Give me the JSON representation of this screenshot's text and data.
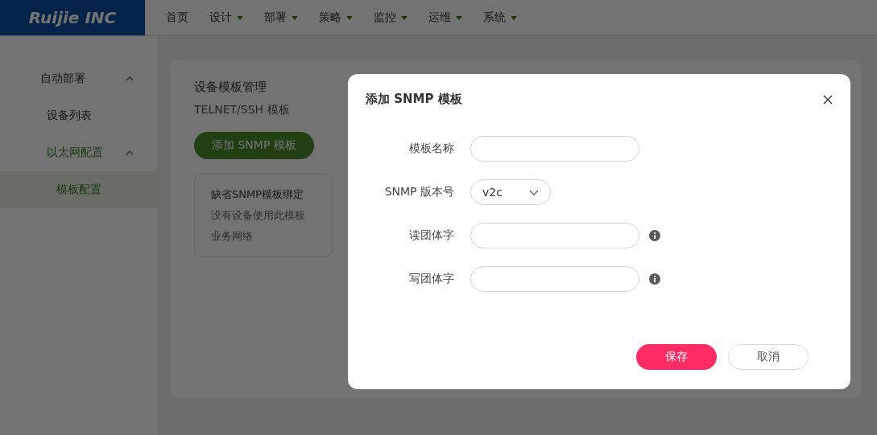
{
  "header": {
    "logo": "Ruijie INC",
    "nav": [
      {
        "label": "首页",
        "dropdown": false
      },
      {
        "label": "设计",
        "dropdown": true
      },
      {
        "label": "部署",
        "dropdown": true
      },
      {
        "label": "策略",
        "dropdown": true
      },
      {
        "label": "监控",
        "dropdown": true
      },
      {
        "label": "运维",
        "dropdown": true
      },
      {
        "label": "系统",
        "dropdown": true
      }
    ]
  },
  "sidebar": {
    "items": [
      {
        "label": "自动部署",
        "expanded": true,
        "selected": false,
        "children": [
          {
            "label": "设备列表",
            "selected": false
          },
          {
            "label": "以太网配置",
            "expanded": true,
            "selected": false,
            "children": [
              {
                "label": "模板配置",
                "selected": true
              }
            ]
          }
        ]
      }
    ]
  },
  "content": {
    "title": "设备模板管理",
    "tab": "TELNET/SSH 模板",
    "add_button": "添加 SNMP 模板",
    "card": {
      "title": "缺省SNMP模板绑定",
      "lines": [
        "没有设备使用此模板",
        "业务网络"
      ]
    }
  },
  "dialog": {
    "title": "添加 SNMP 模板",
    "fields": [
      {
        "kind": "input",
        "label": "模板名称",
        "info": false
      },
      {
        "kind": "select",
        "label": "SNMP 版本号",
        "value": "v2c",
        "info": false
      },
      {
        "kind": "input",
        "label": "读团体字",
        "info": true
      },
      {
        "kind": "input",
        "label": "写团体字",
        "info": true
      }
    ],
    "buttons": [
      {
        "label": "保存",
        "primary": true
      },
      {
        "label": "取消",
        "primary": false
      }
    ]
  }
}
